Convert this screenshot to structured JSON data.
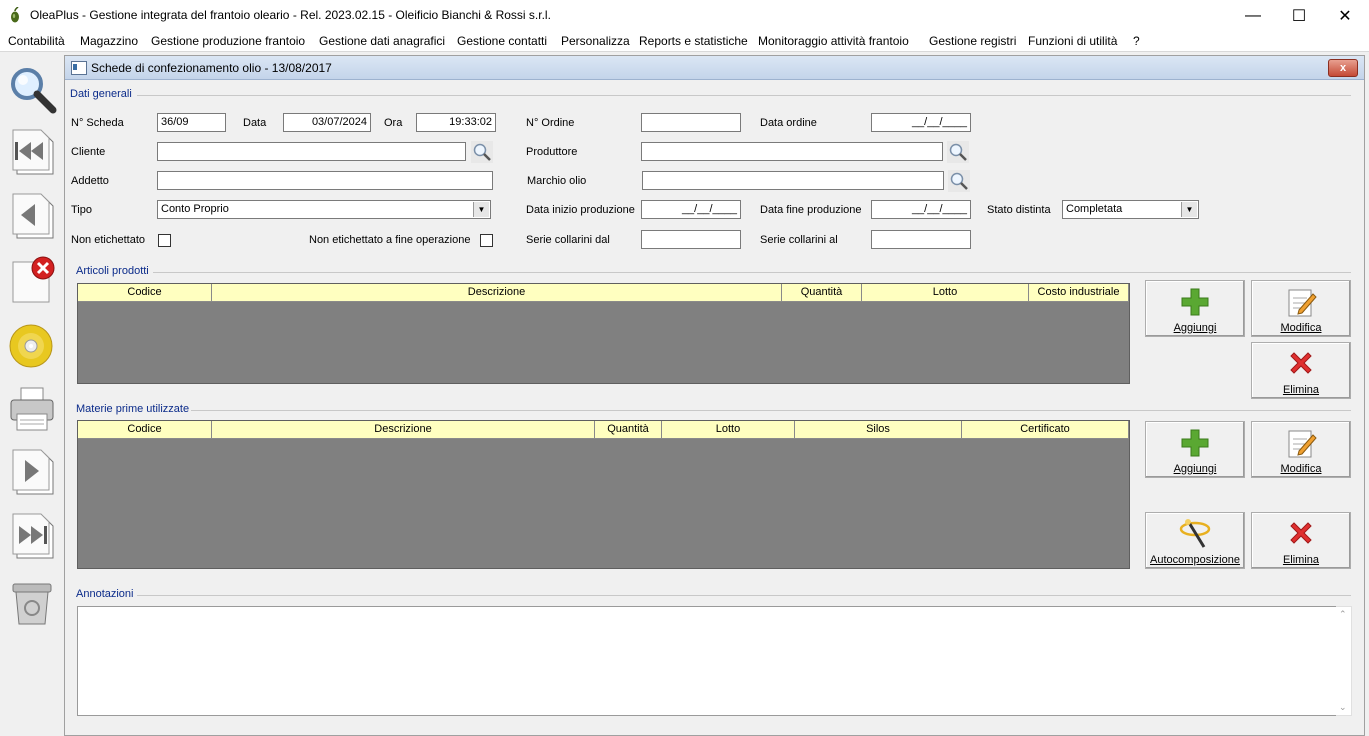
{
  "window": {
    "title": "OleaPlus - Gestione integrata del frantoio oleario - Rel. 2023.02.15 - Oleificio Bianchi & Rossi s.r.l.",
    "minimize": "—",
    "maximize": "☐",
    "close": "✕"
  },
  "menu": [
    "Contabilità",
    "Magazzino",
    "Gestione produzione frantoio",
    "Gestione dati anagrafici",
    "Gestione contatti",
    "Personalizza",
    "Reports e statistiche",
    "Monitoraggio attività frantoio",
    "Gestione registri",
    "Funzioni di utilità",
    "?"
  ],
  "toolbar_icons": [
    "search-icon",
    "first-record-icon",
    "previous-record-icon",
    "delete-record-icon",
    "save-disc-icon",
    "print-icon",
    "next-record-icon",
    "last-record-icon",
    "recycle-bin-icon"
  ],
  "child": {
    "title": "Schede di confezionamento olio - 13/08/2017",
    "close": "x"
  },
  "dati_generali": {
    "section": "Dati generali",
    "n_scheda_label": "N° Scheda",
    "n_scheda": "36/09",
    "data_label": "Data",
    "data": "03/07/2024",
    "ora_label": "Ora",
    "ora": "19:33:02",
    "n_ordine_label": "N° Ordine",
    "n_ordine": "",
    "data_ordine_label": "Data ordine",
    "data_ordine": "__/__/____",
    "cliente_label": "Cliente",
    "cliente": "",
    "produttore_label": "Produttore",
    "produttore": "",
    "addetto_label": "Addetto",
    "addetto": "",
    "marchio_label": "Marchio olio",
    "marchio": "",
    "tipo_label": "Tipo",
    "tipo": "Conto Proprio",
    "data_inizio_label": "Data inizio produzione",
    "data_inizio": "__/__/____",
    "data_fine_label": "Data fine produzione",
    "data_fine": "__/__/____",
    "stato_label": "Stato distinta",
    "stato": "Completata",
    "non_etichettato_label": "Non etichettato",
    "non_etich_fine_label": "Non etichettato a fine operazione",
    "serie_dal_label": "Serie collarini dal",
    "serie_dal": "",
    "serie_al_label": "Serie collarini al",
    "serie_al": ""
  },
  "articoli": {
    "section": "Articoli prodotti",
    "columns": [
      "Codice",
      "Descrizione",
      "Quantità",
      "Lotto",
      "Costo industriale"
    ],
    "buttons": {
      "add": "Aggiungi",
      "edit": "Modifica",
      "delete": "Elimina"
    }
  },
  "materie": {
    "section": "Materie prime utilizzate",
    "columns": [
      "Codice",
      "Descrizione",
      "Quantità",
      "Lotto",
      "Silos",
      "Certificato"
    ],
    "buttons": {
      "add": "Aggiungi",
      "edit": "Modifica",
      "auto": "Autocomposizione",
      "delete": "Elimina"
    }
  },
  "annotazioni": {
    "section": "Annotazioni",
    "value": ""
  }
}
